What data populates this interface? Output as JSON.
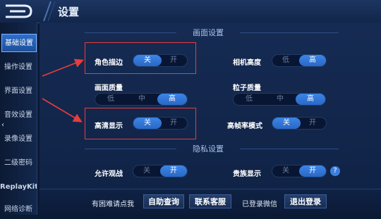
{
  "header": {
    "title": "设置"
  },
  "sidebar": {
    "items": [
      {
        "label": "基础设置",
        "active": true
      },
      {
        "label": "操作设置"
      },
      {
        "label": "界面设置"
      },
      {
        "label": "音效设置"
      },
      {
        "label": "录像设置"
      },
      {
        "label": "二级密码"
      },
      {
        "label": "ReplayKit"
      },
      {
        "label": "网络诊断"
      }
    ]
  },
  "sections": {
    "display": "画面设置",
    "privacy": "隐私设置"
  },
  "settings": {
    "outline": {
      "label": "角色描边",
      "options": [
        "关",
        "开"
      ],
      "selected": "关"
    },
    "camera": {
      "label": "相机高度",
      "options": [
        "低",
        "高"
      ],
      "selected": "高"
    },
    "quality": {
      "label": "画面质量",
      "options": [
        "低",
        "中",
        "高"
      ],
      "selected": "高"
    },
    "particle": {
      "label": "粒子质量",
      "options": [
        "低",
        "中",
        "高"
      ],
      "selected": "高"
    },
    "hd": {
      "label": "高清显示",
      "options": [
        "关",
        "开"
      ],
      "selected": "关"
    },
    "highfps": {
      "label": "高帧率模式",
      "options": [
        "关",
        "开"
      ],
      "selected": "关"
    },
    "spectate": {
      "label": "允许观战",
      "options": [
        "关",
        "开"
      ],
      "selected": "开"
    },
    "noble": {
      "label": "贵族显示",
      "options": [
        "关",
        "开"
      ],
      "selected": "开"
    }
  },
  "bottom": {
    "help_text": "有困难请点我",
    "self_service": "自助查询",
    "contact": "联系客服",
    "login_status": "已登录微信",
    "logout": "退出登录"
  },
  "colors": {
    "accent": "#3b86e8",
    "annotation": "#e53d3d",
    "background": "#0b1a33"
  }
}
